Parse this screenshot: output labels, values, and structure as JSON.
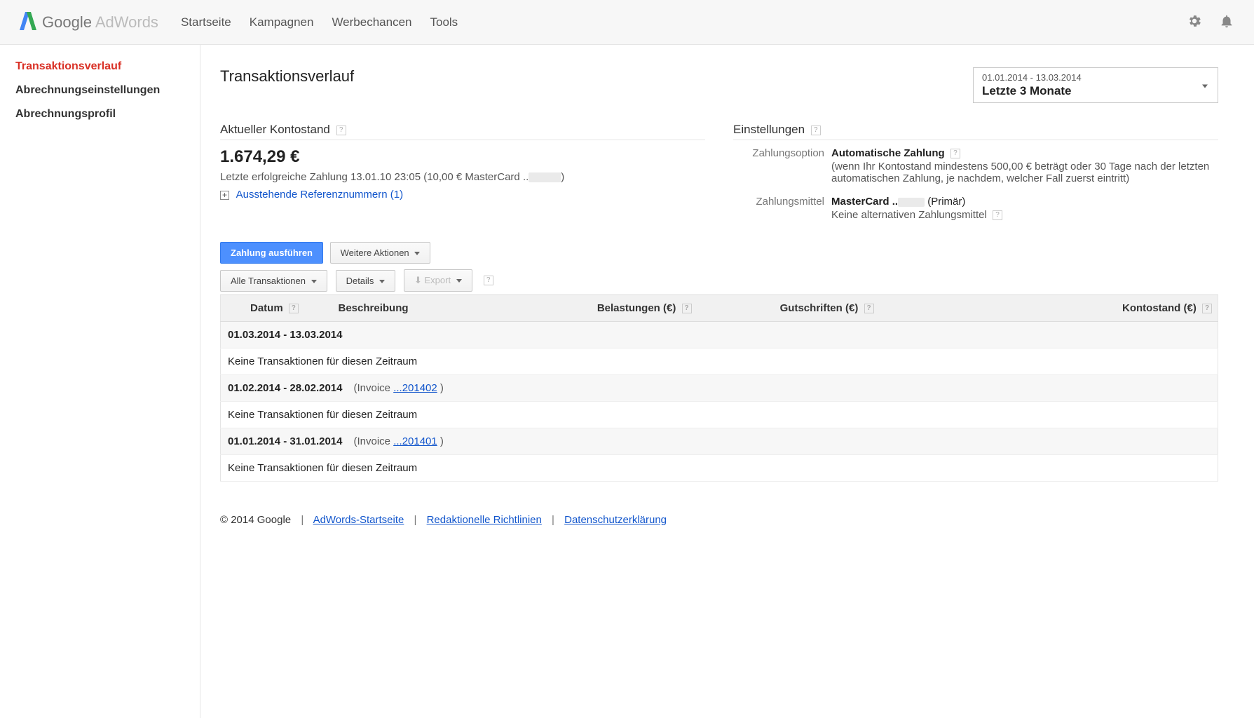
{
  "brand": {
    "name1": "Google",
    "name2": " AdWords"
  },
  "nav": [
    "Startseite",
    "Kampagnen",
    "Werbechancen",
    "Tools"
  ],
  "sidebar": {
    "items": [
      {
        "label": "Transaktionsverlauf",
        "active": true
      },
      {
        "label": "Abrechnungseinstellungen"
      },
      {
        "label": "Abrechnungsprofil"
      }
    ]
  },
  "page": {
    "title": "Transaktionsverlauf"
  },
  "date_picker": {
    "range": "01.01.2014 - 13.03.2014",
    "label": "Letzte 3 Monate"
  },
  "balance": {
    "heading": "Aktueller Kontostand",
    "amount": "1.674,29 €",
    "last_payment_prefix": "Letzte erfolgreiche Zahlung 13.01.10 23:05 (10,00 € MasterCard ..",
    "last_payment_suffix": ")",
    "pending_refs": "Ausstehende Referenznummern (1)"
  },
  "settings": {
    "heading": "Einstellungen",
    "option_label": "Zahlungsoption",
    "option_value": "Automatische Zahlung",
    "option_note": "(wenn Ihr Kontostand mindestens 500,00 € beträgt oder 30 Tage nach der letzten automatischen Zahlung, je nachdem, welcher Fall zuerst eintritt)",
    "method_label": "Zahlungsmittel",
    "method_value_prefix": "MasterCard ..",
    "method_value_suffix": " (Primär)",
    "no_alt": "Keine alternativen Zahlungsmittel"
  },
  "actions": {
    "pay": "Zahlung ausführen",
    "more": "Weitere Aktionen",
    "filter": "Alle Transaktionen",
    "details": "Details",
    "export": "Export"
  },
  "table": {
    "headers": {
      "date": "Datum",
      "desc": "Beschreibung",
      "debit": "Belastungen (€)",
      "credit": "Gutschriften (€)",
      "balance": "Kontostand (€)"
    },
    "periods": [
      {
        "range": "01.03.2014 - 13.03.2014",
        "invoice_prefix": "",
        "invoice_link": "",
        "invoice_suffix": "",
        "empty": "Keine Transaktionen für diesen Zeitraum"
      },
      {
        "range": "01.02.2014 - 28.02.2014",
        "invoice_prefix": "(Invoice ",
        "invoice_link": "...201402",
        "invoice_suffix": " )",
        "empty": "Keine Transaktionen für diesen Zeitraum"
      },
      {
        "range": "01.01.2014 - 31.01.2014",
        "invoice_prefix": "(Invoice ",
        "invoice_link": "...201401",
        "invoice_suffix": " )",
        "empty": "Keine Transaktionen für diesen Zeitraum"
      }
    ]
  },
  "footer": {
    "copyright": "© 2014 Google",
    "links": [
      "AdWords-Startseite",
      "Redaktionelle Richtlinien",
      "Datenschutzerklärung"
    ]
  }
}
